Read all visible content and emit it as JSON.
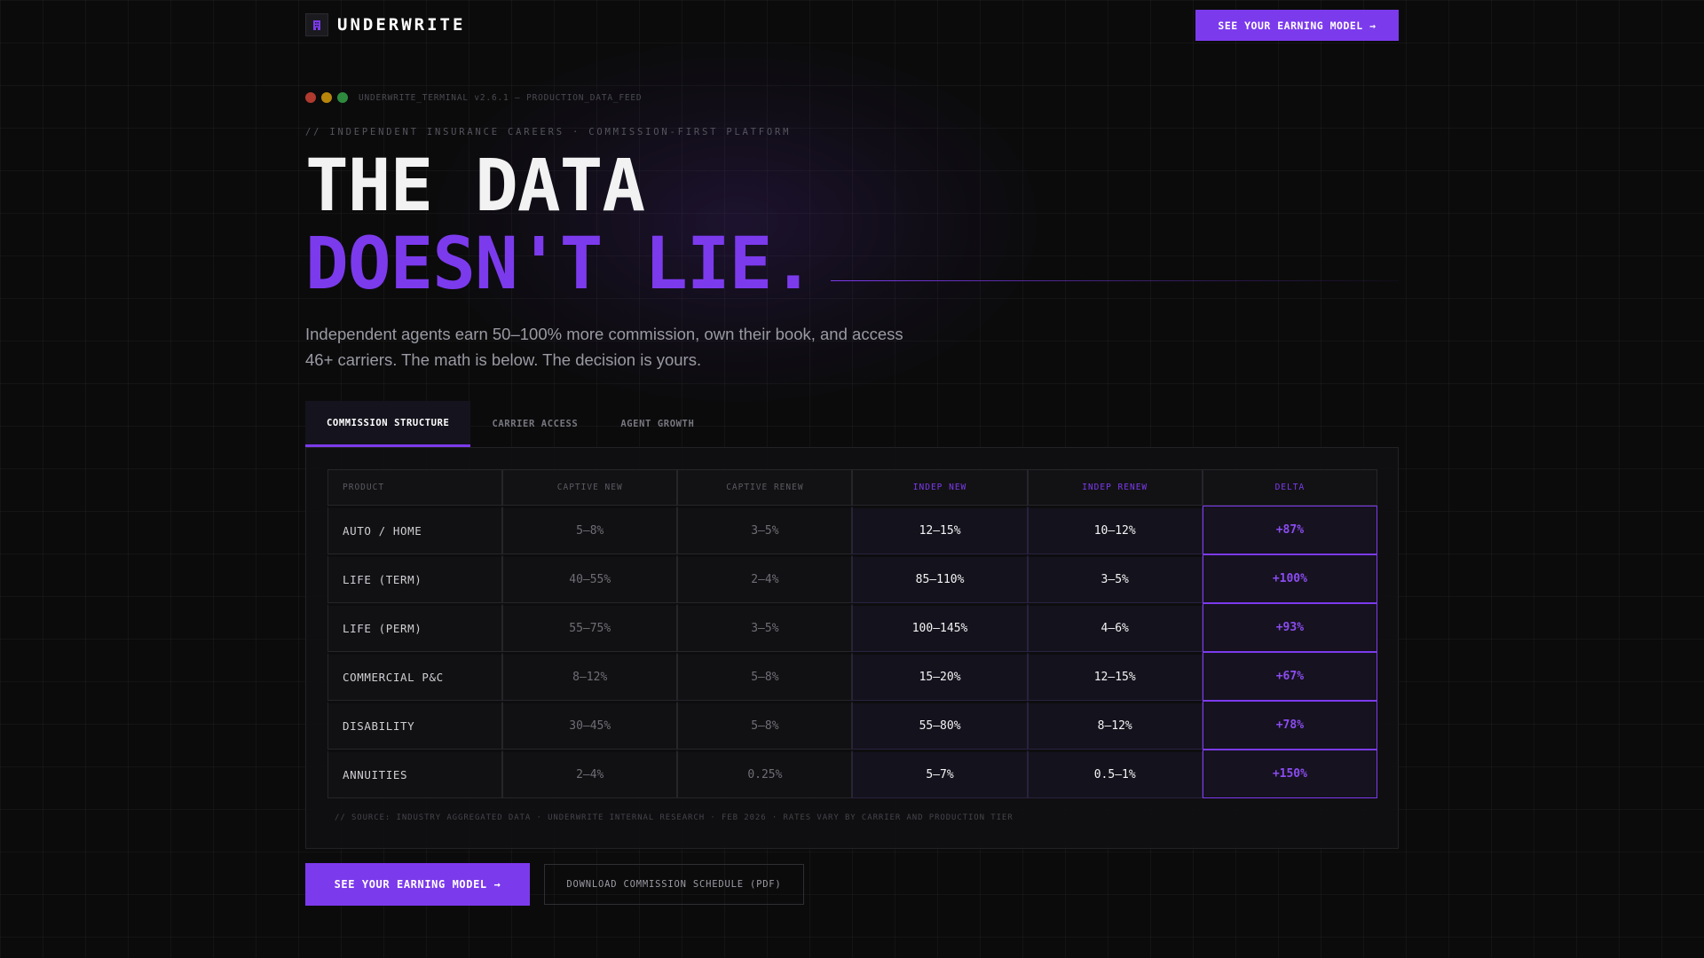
{
  "nav": {
    "brand": "UNDERWRITE",
    "logo_icon": "building-icon",
    "cta": "SEE YOUR EARNING MODEL →"
  },
  "terminal": {
    "dots": [
      "#b03a2e",
      "#b8860b",
      "#2e8b3e"
    ],
    "label": "UNDERWRITE_TERMINAL v2.6.1 — PRODUCTION_DATA_FEED"
  },
  "hero": {
    "kicker": "// INDEPENDENT INSURANCE CAREERS · COMMISSION-FIRST PLATFORM",
    "title_line1": "THE DATA",
    "title_line2": "DOESN'T LIE.",
    "subtitle": "Independent agents earn 50–100% more commission, own their book, and access 46+ carriers. The math is below. The decision is yours."
  },
  "tabs": [
    {
      "label": "COMMISSION STRUCTURE",
      "active": true
    },
    {
      "label": "CARRIER ACCESS",
      "active": false
    },
    {
      "label": "AGENT GROWTH",
      "active": false
    }
  ],
  "table": {
    "headers": [
      "PRODUCT",
      "CAPTIVE NEW",
      "CAPTIVE RENEW",
      "INDEP NEW",
      "INDEP RENEW",
      "DELTA"
    ],
    "rows": [
      [
        "AUTO / HOME",
        "5–8%",
        "3–5%",
        "12–15%",
        "10–12%",
        "+87%"
      ],
      [
        "LIFE (TERM)",
        "40–55%",
        "2–4%",
        "85–110%",
        "3–5%",
        "+100%"
      ],
      [
        "LIFE (PERM)",
        "55–75%",
        "3–5%",
        "100–145%",
        "4–6%",
        "+93%"
      ],
      [
        "COMMERCIAL P&C",
        "8–12%",
        "5–8%",
        "15–20%",
        "12–15%",
        "+67%"
      ],
      [
        "DISABILITY",
        "30–45%",
        "5–8%",
        "55–80%",
        "8–12%",
        "+78%"
      ],
      [
        "ANNUITIES",
        "2–4%",
        "0.25%",
        "5–7%",
        "0.5–1%",
        "+150%"
      ]
    ],
    "source": "// SOURCE: INDUSTRY AGGREGATED DATA · UNDERWRITE INTERNAL RESEARCH · FEB 2026 · RATES VARY BY CARRIER AND PRODUCTION TIER"
  },
  "actions": {
    "primary": "SEE YOUR EARNING MODEL →",
    "secondary": "DOWNLOAD COMMISSION SCHEDULE (PDF)"
  },
  "colors": {
    "accent": "#7c3aed",
    "background": "#0b0b0c"
  }
}
